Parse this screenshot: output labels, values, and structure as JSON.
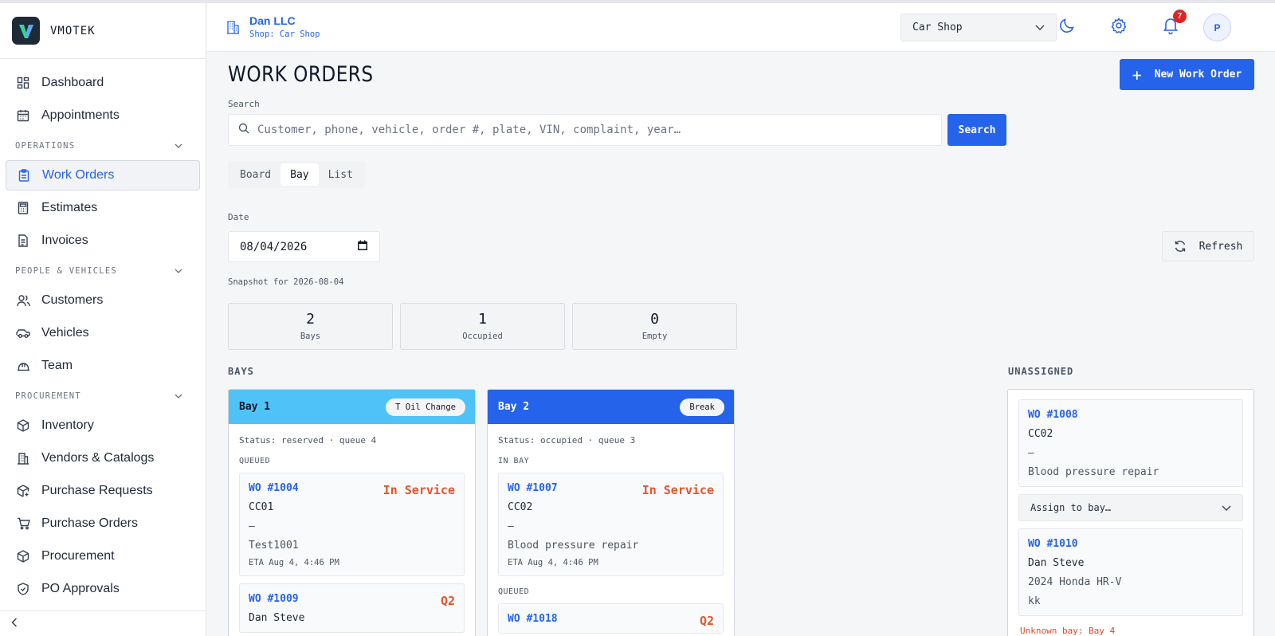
{
  "brand": {
    "name": "VMOTEK"
  },
  "sidebar": {
    "top_items": [
      {
        "label": "Dashboard",
        "icon": "dashboard-icon"
      },
      {
        "label": "Appointments",
        "icon": "calendar-icon"
      }
    ],
    "sections": [
      {
        "title": "OPERATIONS",
        "items": [
          {
            "label": "Work Orders",
            "icon": "clipboard-icon",
            "active": true
          },
          {
            "label": "Estimates",
            "icon": "calculator-icon"
          },
          {
            "label": "Invoices",
            "icon": "document-icon"
          }
        ]
      },
      {
        "title": "PEOPLE & VEHICLES",
        "items": [
          {
            "label": "Customers",
            "icon": "users-icon"
          },
          {
            "label": "Vehicles",
            "icon": "car-icon"
          },
          {
            "label": "Team",
            "icon": "hardhat-icon"
          }
        ]
      },
      {
        "title": "PROCUREMENT",
        "items": [
          {
            "label": "Inventory",
            "icon": "box-icon"
          },
          {
            "label": "Vendors & Catalogs",
            "icon": "building-icon"
          },
          {
            "label": "Purchase Requests",
            "icon": "box-plus-icon"
          },
          {
            "label": "Purchase Orders",
            "icon": "cart-icon"
          },
          {
            "label": "Procurement",
            "icon": "box-icon"
          },
          {
            "label": "PO Approvals",
            "icon": "shield-check-icon"
          }
        ]
      }
    ]
  },
  "header": {
    "company": "Dan LLC",
    "shop_line": "Shop: Car Shop",
    "shop_select": "Car Shop",
    "notifications": "7",
    "avatar": "P"
  },
  "main": {
    "title": "WORK ORDERS",
    "new_button": "New Work Order",
    "search_label": "Search",
    "search_placeholder": "Customer, phone, vehicle, order #, plate, VIN, complaint, year…",
    "search_button": "Search",
    "tabs": [
      "Board",
      "Bay",
      "List"
    ],
    "active_tab": "Bay",
    "date_label": "Date",
    "date_value": "08/04/2026",
    "refresh": "Refresh",
    "snapshot": "Snapshot for 2026-08-04",
    "stats": [
      {
        "value": "2",
        "label": "Bays"
      },
      {
        "value": "1",
        "label": "Occupied"
      },
      {
        "value": "0",
        "label": "Empty"
      }
    ],
    "bays_heading": "BAYS",
    "unassigned_heading": "UNASSIGNED"
  },
  "bays": [
    {
      "name": "Bay 1",
      "pill": "T Oil Change",
      "color": "#4fc3f7",
      "status": "Status: reserved · queue 4",
      "group1": "QUEUED",
      "card1": {
        "wo": "WO #1004",
        "state": "In Service",
        "line1": "CC01",
        "line2": "—",
        "line3": "Test1001",
        "eta": "ETA Aug 4, 4:46 PM"
      },
      "group2": "",
      "card2": {
        "wo": "WO #1009",
        "state": "Q2",
        "line1": "Dan Steve"
      }
    },
    {
      "name": "Bay 2",
      "pill": "Break",
      "color": "#2563eb",
      "status": "Status: occupied · queue 3",
      "group1": "IN BAY",
      "card1": {
        "wo": "WO #1007",
        "state": "In Service",
        "line1": "CC02",
        "line2": "—",
        "line3": "Blood pressure repair",
        "eta": "ETA Aug 4, 4:46 PM"
      },
      "group2": "QUEUED",
      "card2": {
        "wo": "WO #1018",
        "state": "Q2"
      }
    }
  ],
  "unassigned": {
    "card1": {
      "wo": "WO #1008",
      "line1": "CC02",
      "line2": "—",
      "line3": "Blood pressure repair"
    },
    "assign": "Assign to bay…",
    "card2": {
      "wo": "WO #1010",
      "line1": "Dan Steve",
      "line2": "2024 Honda HR-V",
      "line3": "kk"
    },
    "warning": "Unknown bay: Bay 4"
  }
}
